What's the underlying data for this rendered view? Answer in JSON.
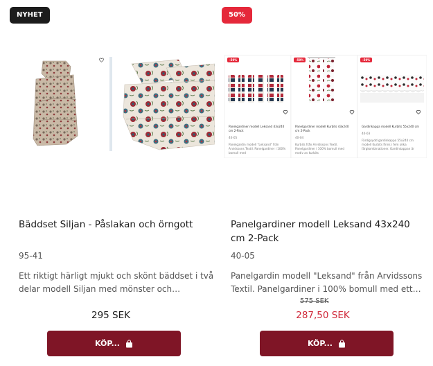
{
  "products": [
    {
      "badge": "NYHET",
      "title": "Bäddset Siljan - Påslakan och örngott",
      "sku": "95-41",
      "description": "Ett riktigt härligt mjukt och skönt bäddset i två delar modell Siljan med mönster och…",
      "price": "295 SEK",
      "button_label": "KÖP...",
      "button_icon": "shopping-bag-icon",
      "images": [
        "duvet-set-folded-photo",
        "duvet-set-on-bed-photo"
      ],
      "wishlist_icon": "heart-icon"
    },
    {
      "badge": "50%",
      "title": "Panelgardiner modell Leksand 43x240 cm 2-Pack",
      "sku": "40-05",
      "description": "Panelgardin modell \"Leksand\" från Arvidssons Textil. Panelgardiner i 100% bomull med ett…",
      "old_price": "575 SEK",
      "price": "287,50 SEK",
      "button_label": "KÖP...",
      "button_icon": "shopping-bag-icon",
      "thumbnails": [
        {
          "badge": "-50%",
          "title": "Panelgardiner modell Leksand 43x240 cm 2-Pack",
          "sku": "40-05",
          "desc": "Panelgardin modell \"Leksand\" från Arvidssons Textil. Panelgardiner i 100% bomull med"
        },
        {
          "badge": "-50%",
          "title": "Panelgardiner modell Kurbits 43x240 cm 2-Pack",
          "sku": "40-04",
          "desc": "Kurbits från Arvidssons Textil. Panelgardiner i 100% bomull med motiv av kurbits"
        },
        {
          "badge": "-50%",
          "title": "Gardinkappa modell Kurbits 55x240 cm",
          "sku": "40-03",
          "desc": "Färdigsydd gardinkappa 55x240 cm modell Kurbits finns i fem olika färgkombinationer. Gardinkappan är"
        }
      ]
    }
  ],
  "colors": {
    "accent_button": "#7f1526",
    "sale_red": "#e5283a",
    "sale_price": "#d0293a",
    "badge_dark": "#1c1c1c"
  }
}
